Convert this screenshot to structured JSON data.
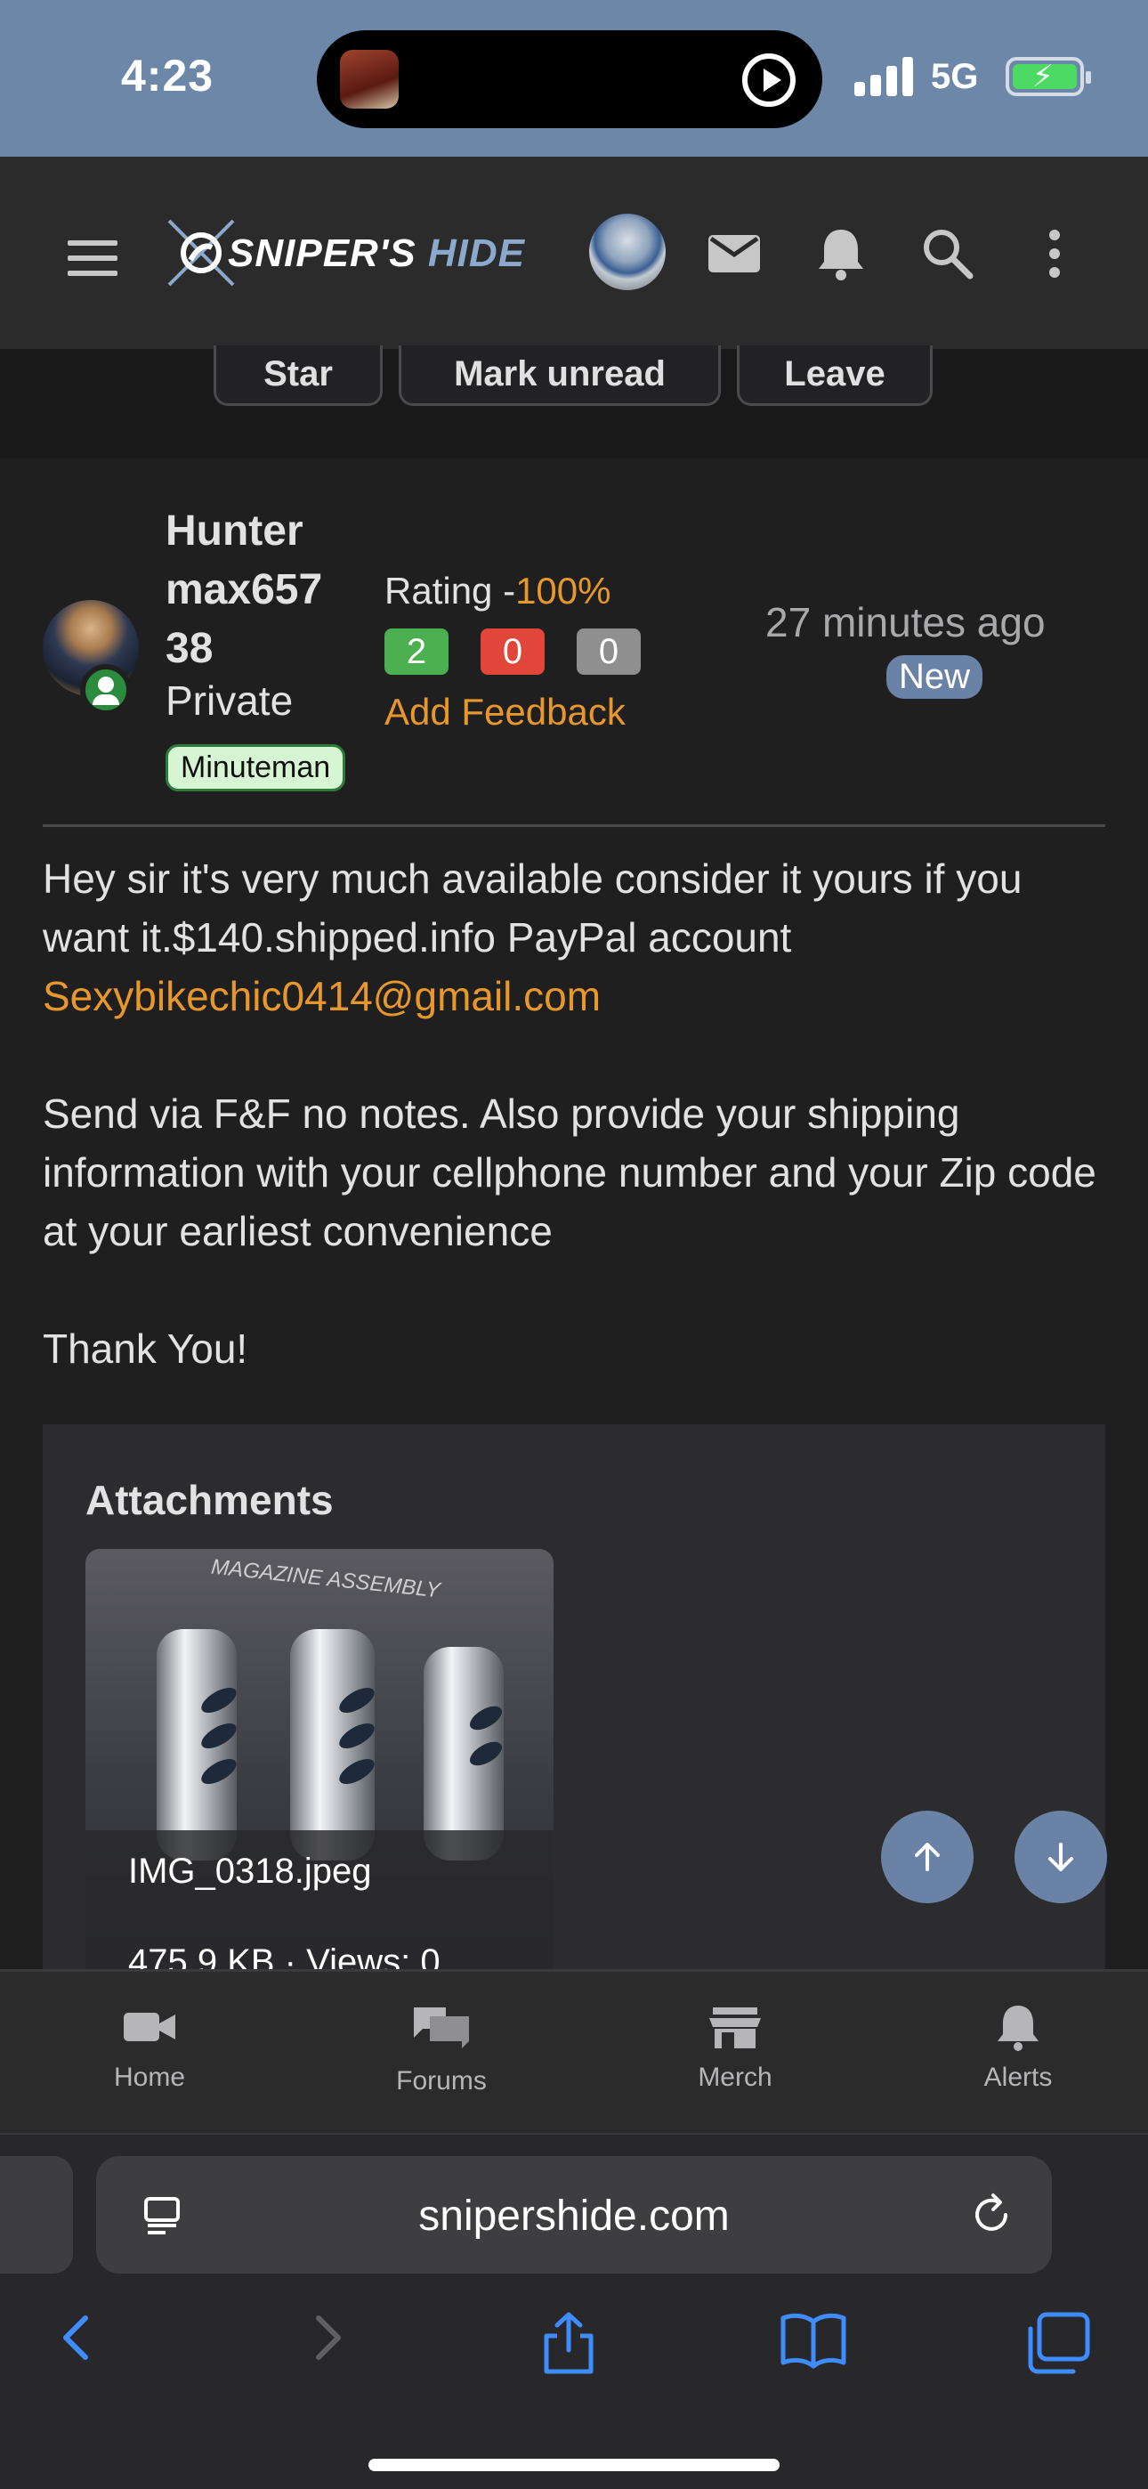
{
  "status_bar": {
    "time": "4:23",
    "network": "5G"
  },
  "header": {
    "logo_text_1": "SNIPER'S",
    "logo_text_2": "HIDE"
  },
  "thread_actions": {
    "star": "Star",
    "mark_unread": "Mark unread",
    "leave": "Leave"
  },
  "post": {
    "username": "Hunter max65738",
    "username_lines": [
      "Hunter",
      "max657",
      "38"
    ],
    "user_title": "Private",
    "user_badge": "Minuteman",
    "rating_label": "Rating -",
    "rating_value": "100%",
    "feedback": {
      "positive": "2",
      "negative": "0",
      "neutral": "0"
    },
    "add_feedback": "Add Feedback",
    "time_ago": "27 minutes ago",
    "new_label": "New",
    "message": {
      "line1": "Hey sir it's very much available consider it yours if you want it.$140.shipped.info PayPal account",
      "email": "Sexybikechic0414@gmail.com",
      "line2": "Send via F&F no notes. Also provide your shipping information with your cellphone number and your Zip code at your earliest convenience",
      "line3": "Thank You!"
    },
    "attachments": {
      "title": "Attachments",
      "image_caption": "MAGAZINE ASSEMBLY",
      "file_name": "IMG_0318.jpeg",
      "file_meta": "475.9 KB · Views: 0"
    }
  },
  "bottom_nav": {
    "home": "Home",
    "forums": "Forums",
    "merch": "Merch",
    "alerts": "Alerts"
  },
  "browser": {
    "url": "snipershide.com"
  },
  "colors": {
    "accent_orange": "#e8982a",
    "accent_blue": "#6a82a6",
    "positive": "#4caf50",
    "negative": "#e0463a",
    "neutral": "#8f8f8f"
  }
}
